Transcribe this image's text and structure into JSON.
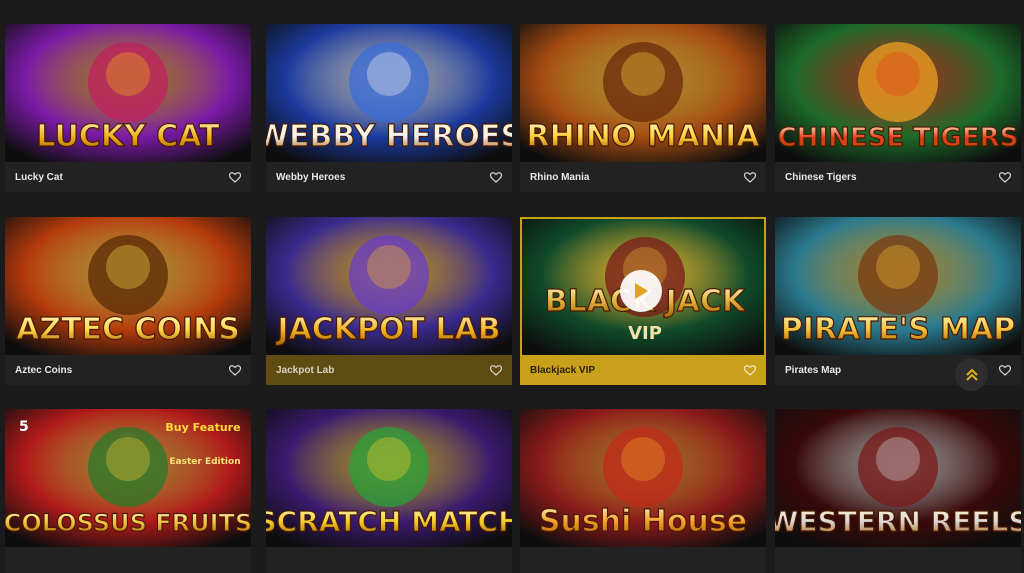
{
  "games": [
    {
      "name": "Lucky Cat",
      "art": "LUCKY CAT",
      "art2": "",
      "colors": [
        "#7a1aa6",
        "#f0b21b",
        "#c02060"
      ]
    },
    {
      "name": "Webby Heroes",
      "art": "WEBBY HEROES",
      "art2": "",
      "colors": [
        "#1b3a9e",
        "#f3f3f3",
        "#3a6cd8"
      ]
    },
    {
      "name": "Rhino Mania",
      "art": "RHINO MANIA",
      "art2": "",
      "colors": [
        "#a34a12",
        "#ffd23a",
        "#6b2a0c"
      ]
    },
    {
      "name": "Chinese Tigers",
      "art": "CHINESE TIGERS",
      "art2": "",
      "colors": [
        "#1d6a2a",
        "#e23b1a",
        "#f0a020"
      ]
    },
    {
      "name": "Aztec Coins",
      "art": "AZTEC COINS",
      "art2": "",
      "colors": [
        "#b33a0c",
        "#ffd84a",
        "#5a2a06"
      ]
    },
    {
      "name": "Jackpot Lab",
      "art": "JACKPOT LAB",
      "art2": "",
      "colors": [
        "#3a2a8e",
        "#f2b628",
        "#6a3ec8"
      ]
    },
    {
      "name": "Blackjack VIP",
      "art": "BLACK JACK",
      "art2": "VIP",
      "colors": [
        "#0f4a2a",
        "#e0b23a",
        "#7a1a1a"
      ]
    },
    {
      "name": "Pirates Map",
      "art": "PIRATE'S MAP",
      "art2": "",
      "colors": [
        "#2a7a8e",
        "#f3c23a",
        "#7a3a12"
      ]
    },
    {
      "name": "",
      "art": "COLOSSUS FRUITS",
      "art2": "Buy Feature",
      "colors": [
        "#b01a1a",
        "#f3c23a",
        "#2a7a2a"
      ]
    },
    {
      "name": "",
      "art": "SCRATCH MATCH",
      "art2": "",
      "colors": [
        "#3a1a6e",
        "#f3d02a",
        "#2aa03a"
      ]
    },
    {
      "name": "",
      "art": "Sushi House",
      "art2": "",
      "colors": [
        "#8a1a1a",
        "#f3a02a",
        "#c22a1a"
      ]
    },
    {
      "name": "",
      "art": "WESTERN REELS",
      "art2": "",
      "colors": [
        "#3a0a0a",
        "#d8d8d8",
        "#7a1a1a"
      ]
    }
  ],
  "badges": {
    "colossus_num": "5",
    "colossus_edition": "Easter Edition"
  },
  "icons": {
    "favorite": "heart-outline-icon",
    "play": "play-icon",
    "scroll_top": "double-chevron-up-icon"
  },
  "accent": "#c9a01a"
}
